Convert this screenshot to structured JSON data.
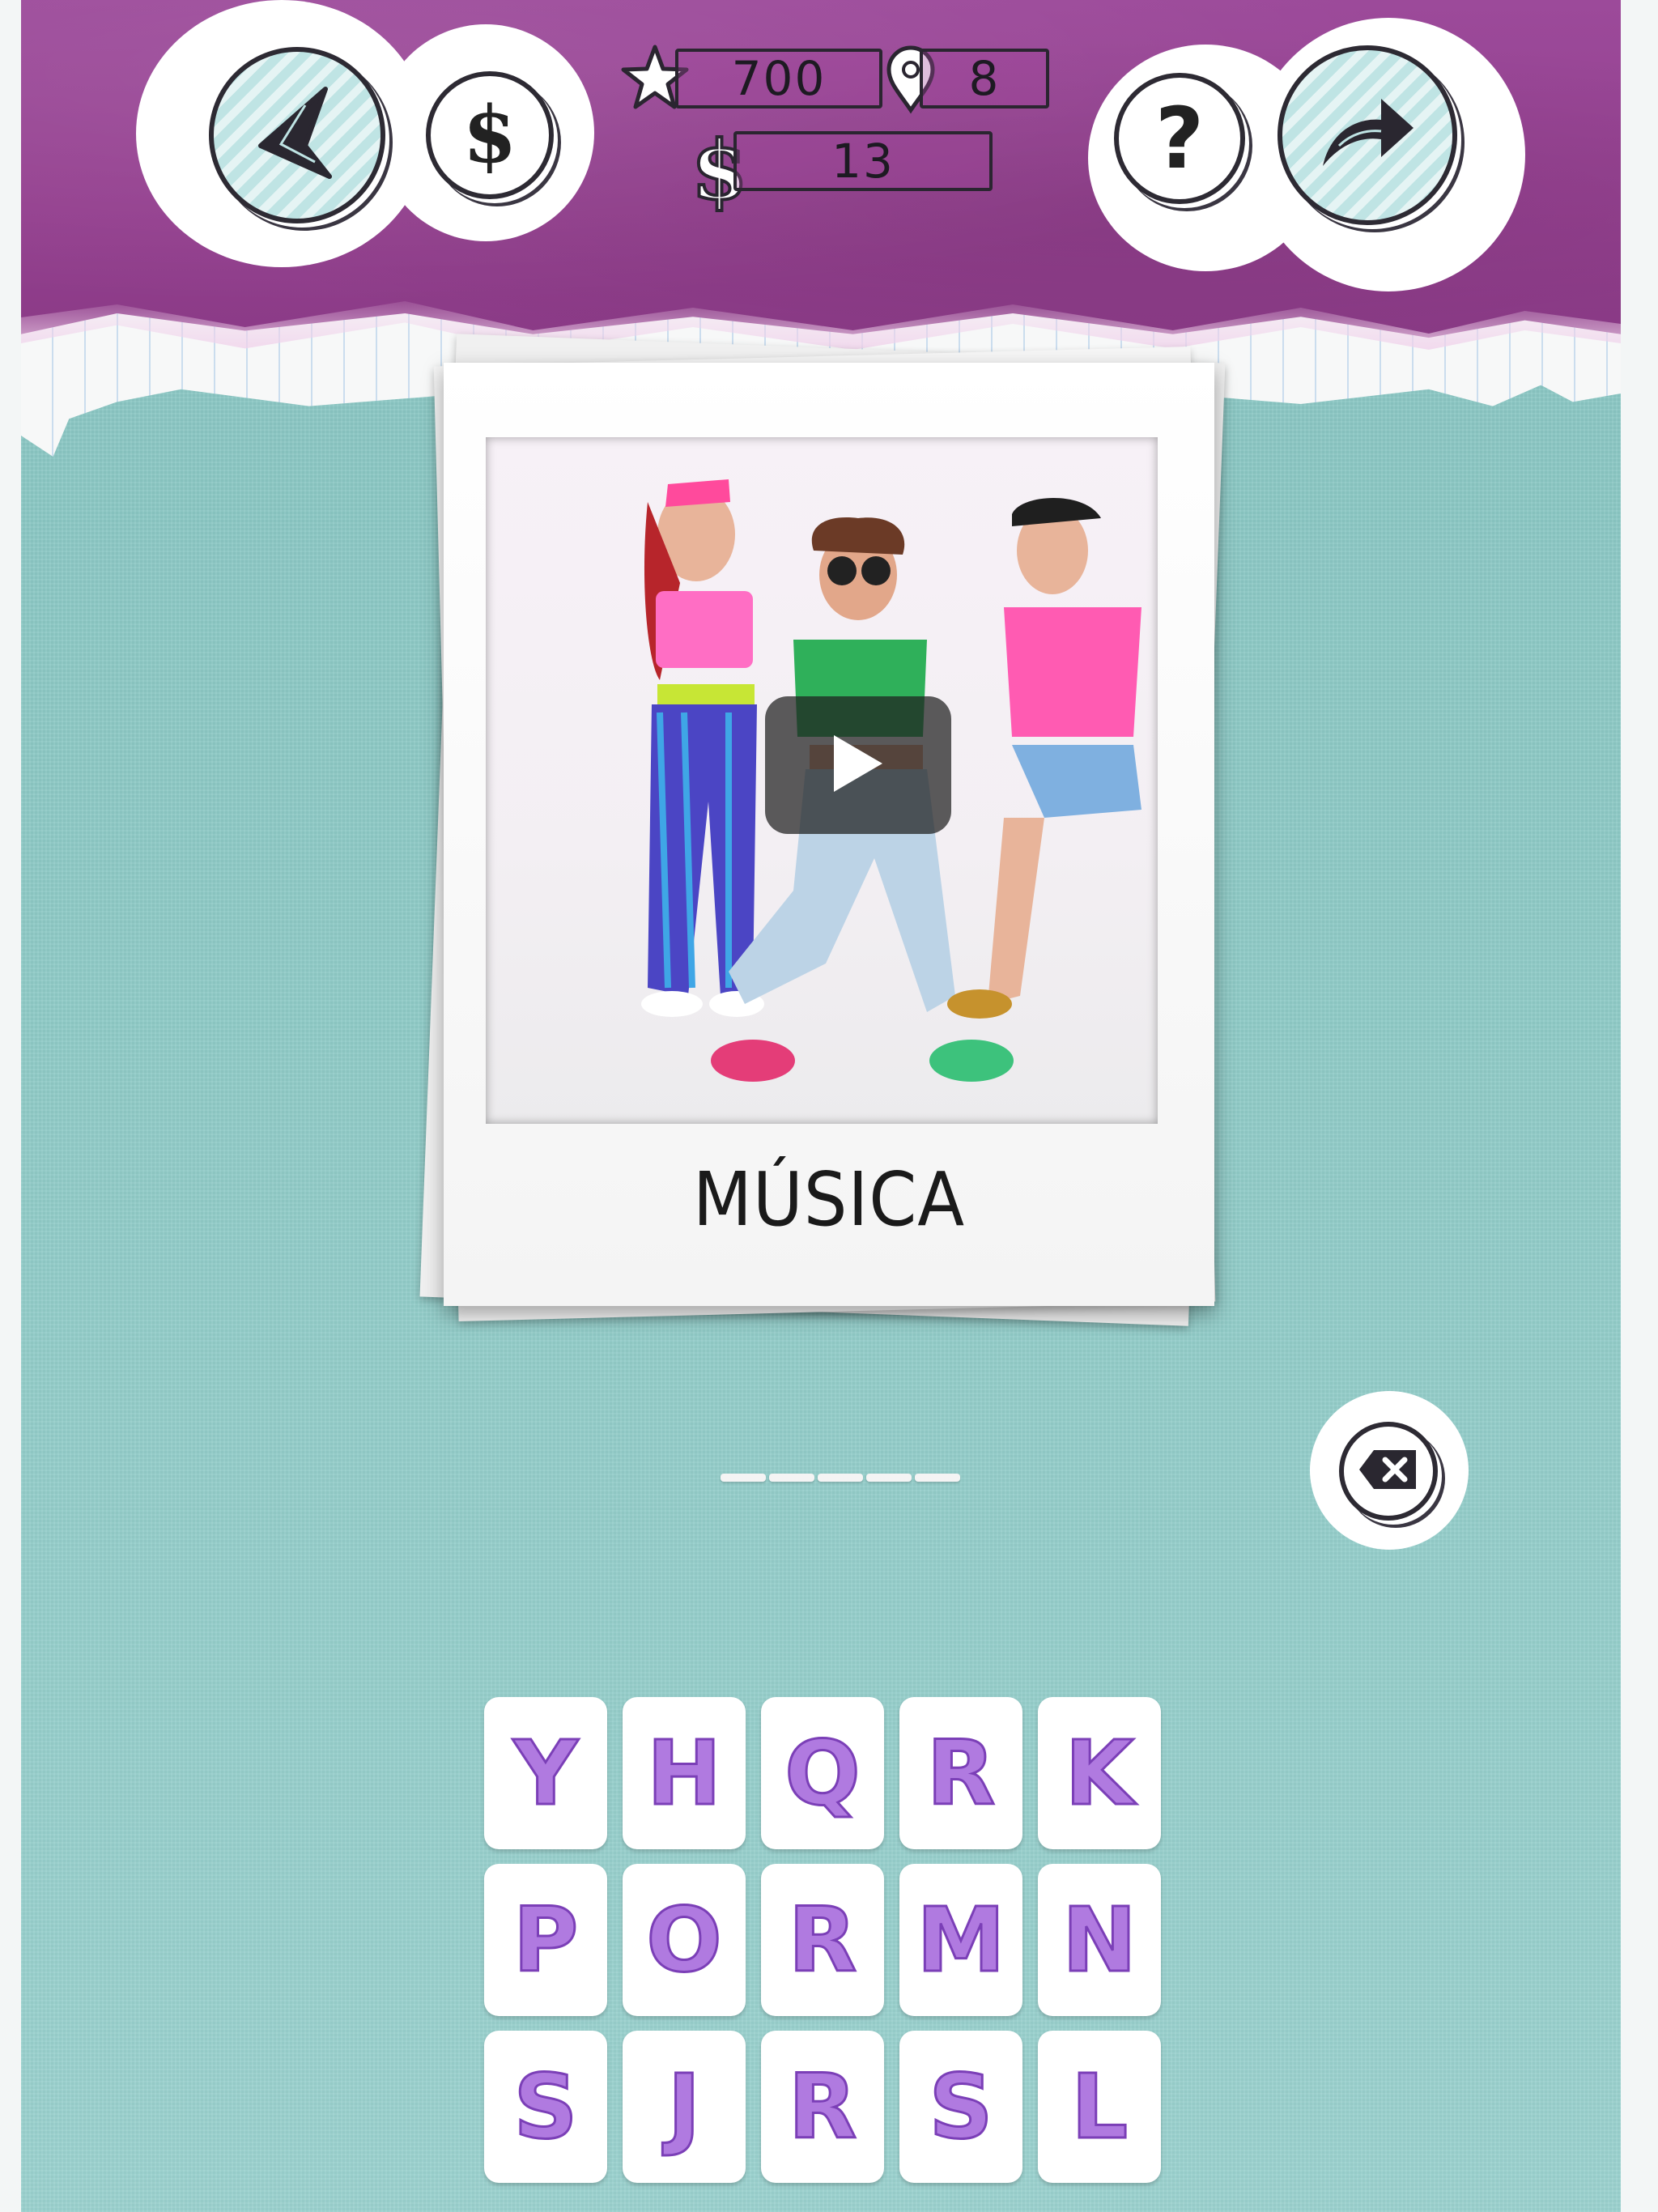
{
  "hud": {
    "score": "700",
    "level": "8",
    "coins": "13"
  },
  "icons": {
    "back": "back-arrow-icon",
    "shop": "dollar-icon",
    "star": "star-icon",
    "location": "location-pin-icon",
    "coin": "dollar-sign-icon",
    "help": "question-icon",
    "share": "share-arrow-icon",
    "play": "play-icon",
    "backspace": "backspace-icon"
  },
  "buttons": {
    "shop_glyph": "$",
    "help_glyph": "?",
    "coin_glyph": "$"
  },
  "puzzle": {
    "category": "MÚSICA",
    "answer_length": 5
  },
  "letters": [
    [
      "Y",
      "H",
      "Q",
      "R",
      "K"
    ],
    [
      "P",
      "O",
      "R",
      "M",
      "N"
    ],
    [
      "S",
      "J",
      "R",
      "S",
      "L"
    ]
  ],
  "colors": {
    "header": "#94408f",
    "background": "#8dc9c5",
    "tile_letter": "#b07ae0"
  }
}
